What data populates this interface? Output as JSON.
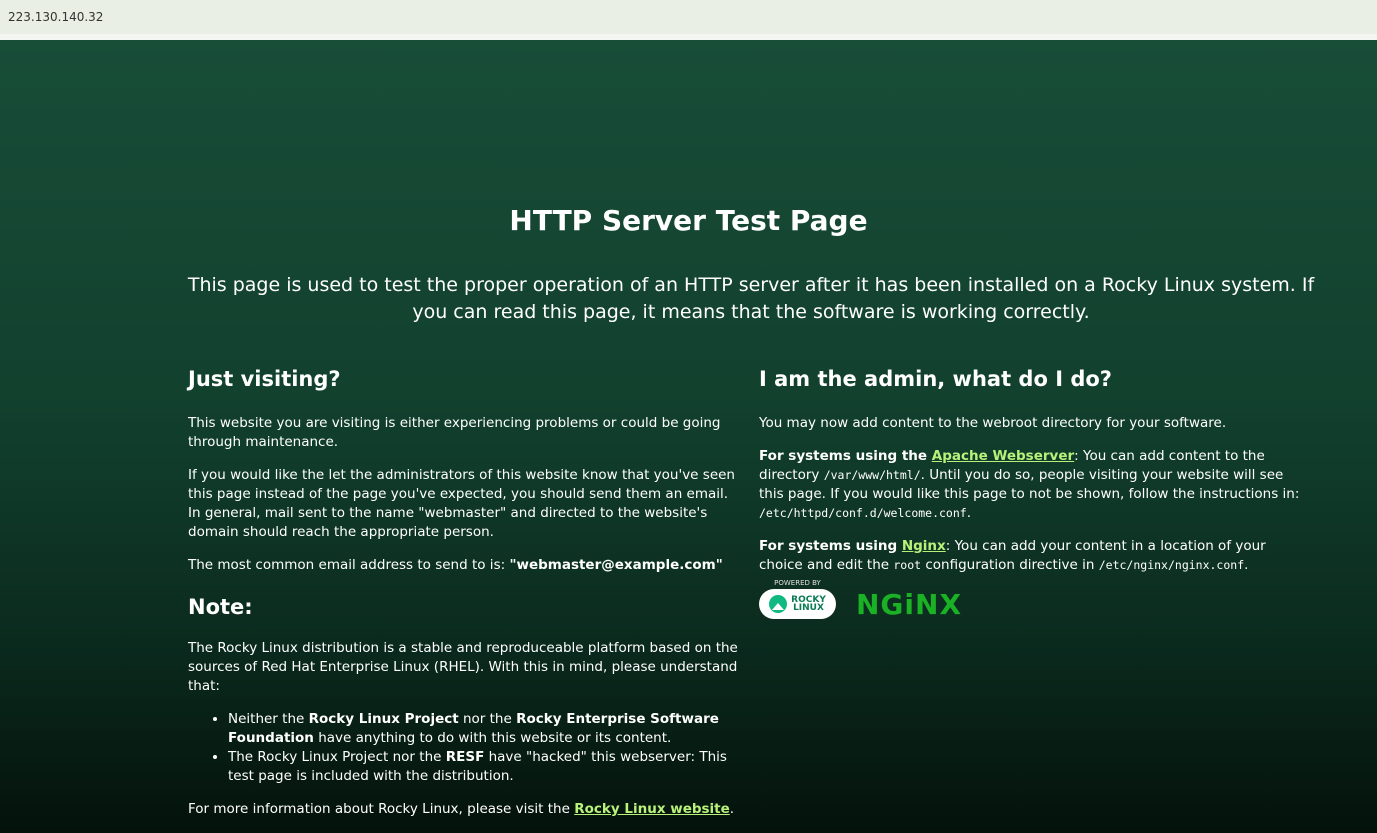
{
  "browser": {
    "address": "223.130.140.32"
  },
  "page": {
    "title": "HTTP Server Test Page",
    "lead": "This page is used to test the proper operation of an HTTP server after it has been installed on a Rocky Linux system. If you can read this page, it means that the software is working correctly."
  },
  "left": {
    "heading": "Just visiting?",
    "p1": "This website you are visiting is either experiencing problems or could be going through maintenance.",
    "p2": "If you would like the let the administrators of this website know that you've seen this page instead of the page you've expected, you should send them an email. In general, mail sent to the name \"webmaster\" and directed to the website's domain should reach the appropriate person.",
    "p3_text": "The most common email address to send to is: ",
    "p3_email": "\"webmaster@example.com\"",
    "note_heading": "Note:",
    "note_p": "The Rocky Linux distribution is a stable and reproduceable platform based on the sources of Red Hat Enterprise Linux (RHEL). With this in mind, please understand that:",
    "li1_a": "Neither the ",
    "li1_b": "Rocky Linux Project",
    "li1_c": " nor the ",
    "li1_d": "Rocky Enterprise Software Foundation",
    "li1_e": " have anything to do with this website or its content.",
    "li2_a": "The Rocky Linux Project nor the ",
    "li2_b": "RESF",
    "li2_c": " have \"hacked\" this webserver: This test page is included with the distribution.",
    "more_text": "For more information about Rocky Linux, please visit the ",
    "more_link": "Rocky Linux website",
    "more_end": "."
  },
  "right": {
    "heading": "I am the admin, what do I do?",
    "p1": "You may now add content to the webroot directory for your software.",
    "apache_prefix": "For systems using the ",
    "apache_link": "Apache Webserver",
    "apache_text1": ": You can add content to the directory ",
    "apache_code1": "/var/www/html/",
    "apache_text2": ". Until you do so, people visiting your website will see this page. If you would like this page to not be shown, follow the instructions in: ",
    "apache_code2": "/etc/httpd/conf.d/welcome.conf",
    "apache_end": ".",
    "nginx_prefix": "For systems using ",
    "nginx_link": "Nginx",
    "nginx_text1": ": You can add your content in a location of your choice and edit the ",
    "nginx_code1": "root",
    "nginx_text2": " configuration directive in ",
    "nginx_code2": "/etc/nginx/nginx.conf",
    "nginx_end": ".",
    "rocky_powered": "POWERED BY",
    "rocky_text1": "ROCKY",
    "rocky_text2": "LINUX",
    "nginx_logo": "NGiNX"
  },
  "colors": {
    "link": "#b8f27a",
    "nginx_green": "#1bb124",
    "rocky_green": "#10b981"
  }
}
